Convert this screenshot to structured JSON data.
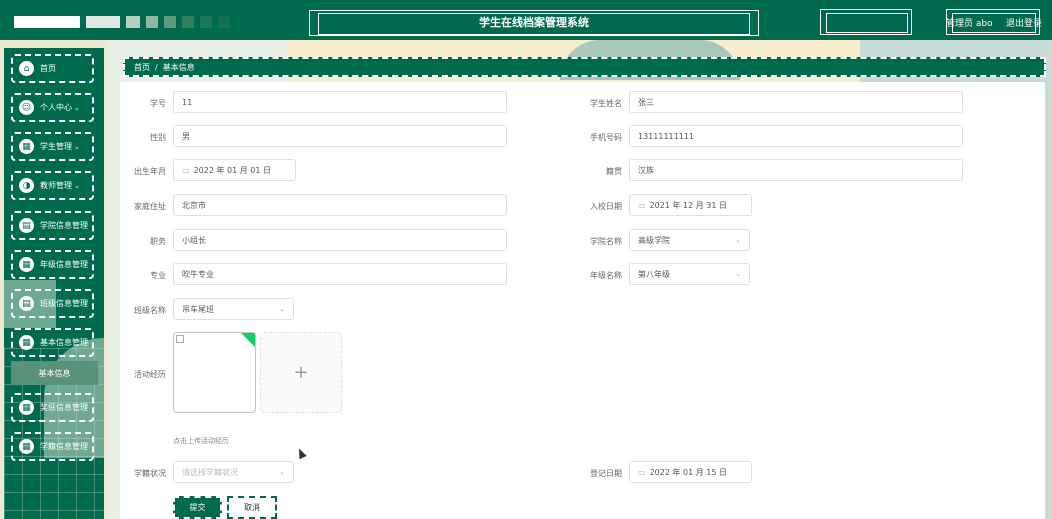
{
  "header": {
    "title": "学生在线档案管理系统",
    "user": "管理员 abo",
    "logout": "退出登录"
  },
  "sidebar": {
    "items": [
      {
        "label": "首页",
        "icon": "home-icon",
        "glyph": "⌂",
        "arrow": ""
      },
      {
        "label": "个人中心",
        "icon": "user-icon",
        "glyph": "☺",
        "arrow": "⌄"
      },
      {
        "label": "学生管理",
        "icon": "grid-icon",
        "glyph": "▦",
        "arrow": "⌄"
      },
      {
        "label": "教师管理",
        "icon": "shield-icon",
        "glyph": "◑",
        "arrow": "⌄"
      },
      {
        "label": "学院信息管理",
        "icon": "document-icon",
        "glyph": "▤",
        "arrow": ""
      },
      {
        "label": "年级信息管理",
        "icon": "grid-icon",
        "glyph": "▦",
        "arrow": ""
      },
      {
        "label": "班级信息管理",
        "icon": "document-icon",
        "glyph": "▤",
        "arrow": ""
      },
      {
        "label": "基本信息管理",
        "icon": "grid-icon",
        "glyph": "▦",
        "arrow": ""
      },
      {
        "label": "奖惩信息管理",
        "icon": "grid-icon",
        "glyph": "▦",
        "arrow": ""
      },
      {
        "label": "学籍信息管理",
        "icon": "grid-icon",
        "glyph": "▦",
        "arrow": ""
      }
    ],
    "sub_active": "基本信息"
  },
  "breadcrumb": {
    "home": "首页",
    "separator": "/",
    "current": "基本信息"
  },
  "form": {
    "student_no_label": "学号",
    "student_no": "11",
    "student_name_label": "学生姓名",
    "student_name": "张三",
    "gender_label": "性别",
    "gender": "男",
    "phone_label": "手机号码",
    "phone": "13111111111",
    "birth_label": "出生年月",
    "birth": "2022 年 01 月 01 日",
    "native_label": "籍贯",
    "native": "汉族",
    "address_label": "家庭住址",
    "address": "北京市",
    "enroll_label": "入校日期",
    "enroll": "2021 年 12 月 31 日",
    "position_label": "职务",
    "position": "小组长",
    "college_label": "学院名称",
    "college": "高级学院",
    "major_label": "专业",
    "major": "吹牛专业",
    "grade_label": "年级名称",
    "grade": "第八年级",
    "class_label": "班级名称",
    "class": "吊车尾班",
    "activity_label": "活动经历",
    "upload_tip": "点击上传活动经历",
    "status_label": "学籍状况",
    "status_placeholder": "请选择学籍状况",
    "register_label": "登记日期",
    "register": "2022 年 01 月 15 日",
    "submit": "提交",
    "cancel": "取消"
  },
  "icons": {
    "calendar": "calendar-icon",
    "chevron": "chevron-down-icon",
    "plus": "plus-icon"
  },
  "colors": {
    "primary": "#006a4e",
    "success": "#13ce66"
  }
}
